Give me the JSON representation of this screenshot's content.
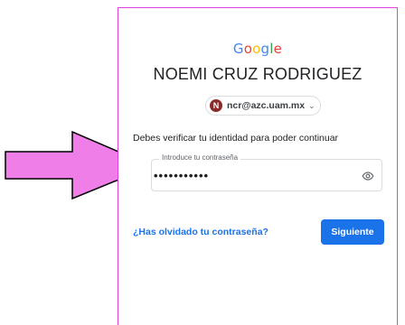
{
  "header": {
    "logo_letters": [
      {
        "char": "G",
        "color": "#4285F4"
      },
      {
        "char": "o",
        "color": "#EA4335"
      },
      {
        "char": "o",
        "color": "#FBBC05"
      },
      {
        "char": "g",
        "color": "#4285F4"
      },
      {
        "char": "l",
        "color": "#34A853"
      },
      {
        "char": "e",
        "color": "#EA4335"
      }
    ],
    "user_name": "NOEMI CRUZ RODRIGUEZ"
  },
  "account": {
    "avatar_letter": "N",
    "email": "ncr@azc.uam.mx",
    "chevron_icon": "chevron-down-icon"
  },
  "form": {
    "subtitle": "Debes verificar tu identidad para poder continuar",
    "password_label": "Introduce tu contraseña",
    "password_value": "•••••••••••",
    "show_password_icon": "eye-icon"
  },
  "actions": {
    "forgot_label": "¿Has olvidado tu contraseña?",
    "next_label": "Siguiente"
  },
  "colors": {
    "accent": "#1a73e8",
    "annotation_arrow": "#f07ee8",
    "card_border": "#e040e0"
  }
}
